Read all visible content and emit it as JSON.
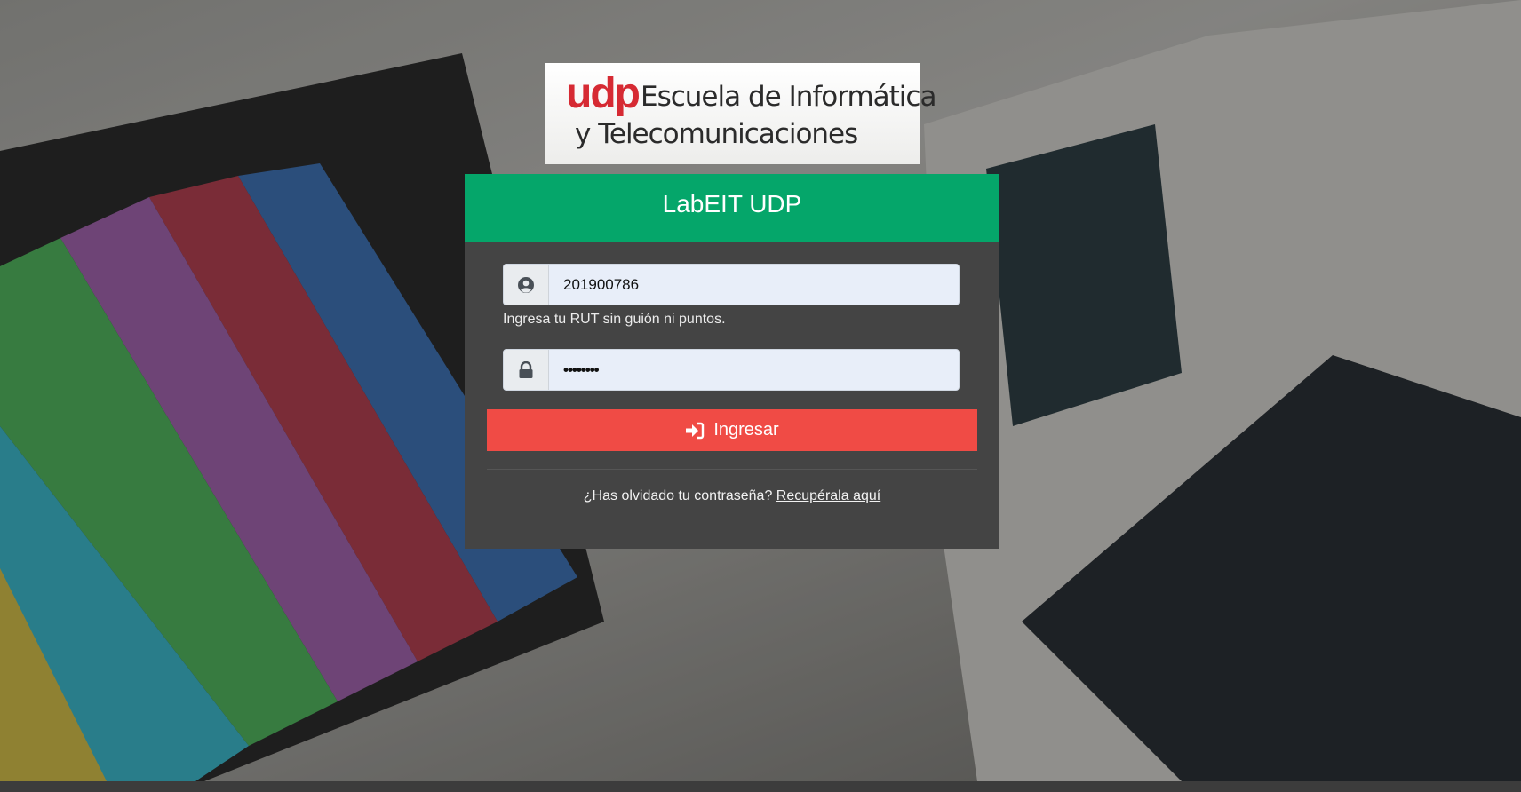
{
  "logo": {
    "brand": "udp",
    "line1": "Escuela de Informática",
    "line2": "y Telecomunicaciones",
    "brand_color": "#d62a33"
  },
  "card": {
    "title": "LabEIT UDP",
    "header_color": "#05a66a",
    "background_color": "#444444"
  },
  "login_form": {
    "username": {
      "icon": "user-circle-icon",
      "value": "201900786",
      "hint": "Ingresa tu RUT sin guión ni puntos."
    },
    "password": {
      "icon": "lock-icon",
      "value": "••••••••"
    },
    "submit": {
      "icon": "sign-in-icon",
      "label": "Ingresar",
      "color": "#f04b45"
    }
  },
  "forgot_password": {
    "question": "¿Has olvidado tu contraseña?",
    "link_label": "Recupérala aquí"
  }
}
